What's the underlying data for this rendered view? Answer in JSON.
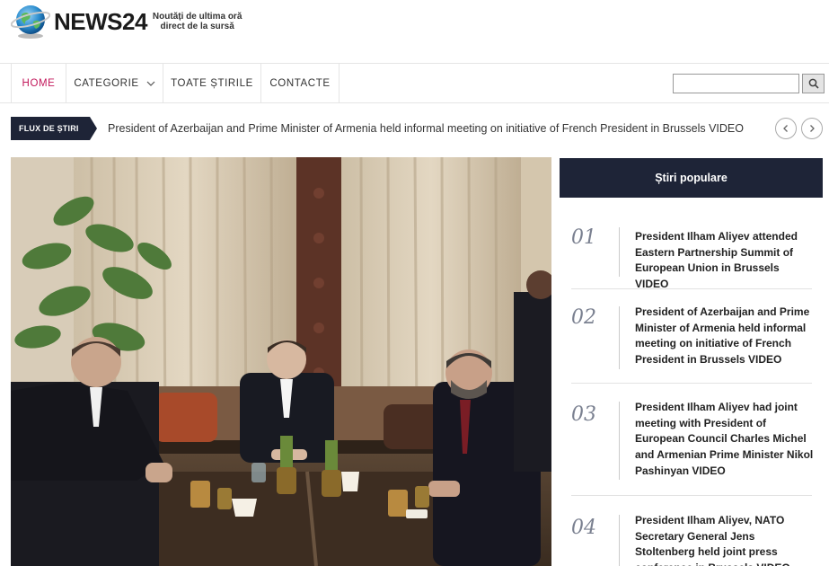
{
  "brand": {
    "name": "NEWS24",
    "tagline_line1": "Noutăți de ultima oră",
    "tagline_line2": "direct de la sursă"
  },
  "nav": {
    "items": [
      {
        "label": "HOME",
        "active": true
      },
      {
        "label": "CATEGORIE",
        "has_dropdown": true
      },
      {
        "label": "TOATE ȘTIRILE"
      },
      {
        "label": "CONTACTE"
      }
    ],
    "search_value": "",
    "search_icon": "search-icon"
  },
  "ticker": {
    "label": "FLUX DE ȘTIRI",
    "headline": "President of Azerbaijan and Prime Minister of Armenia held informal meeting on initiative of French President in Brussels VIDEO"
  },
  "popular": {
    "title": "Știri populare",
    "items": [
      {
        "num": "01",
        "title": "President Ilham Aliyev attended Eastern Partnership Summit of European Union in Brussels VIDEO"
      },
      {
        "num": "02",
        "title": "President of Azerbaijan and Prime Minister of Armenia held informal meeting on initiative of French President in Brussels VIDEO"
      },
      {
        "num": "03",
        "title": "President Ilham Aliyev had joint meeting with President of European Council Charles Michel and Armenian Prime Minister Nikol Pashinyan VIDEO"
      },
      {
        "num": "04",
        "title": "President Ilham Aliyev, NATO Secretary General Jens Stoltenberg held joint press conference in Brussels VIDEO"
      }
    ]
  },
  "colors": {
    "accent": "#c2185b",
    "navy": "#1e2437"
  }
}
